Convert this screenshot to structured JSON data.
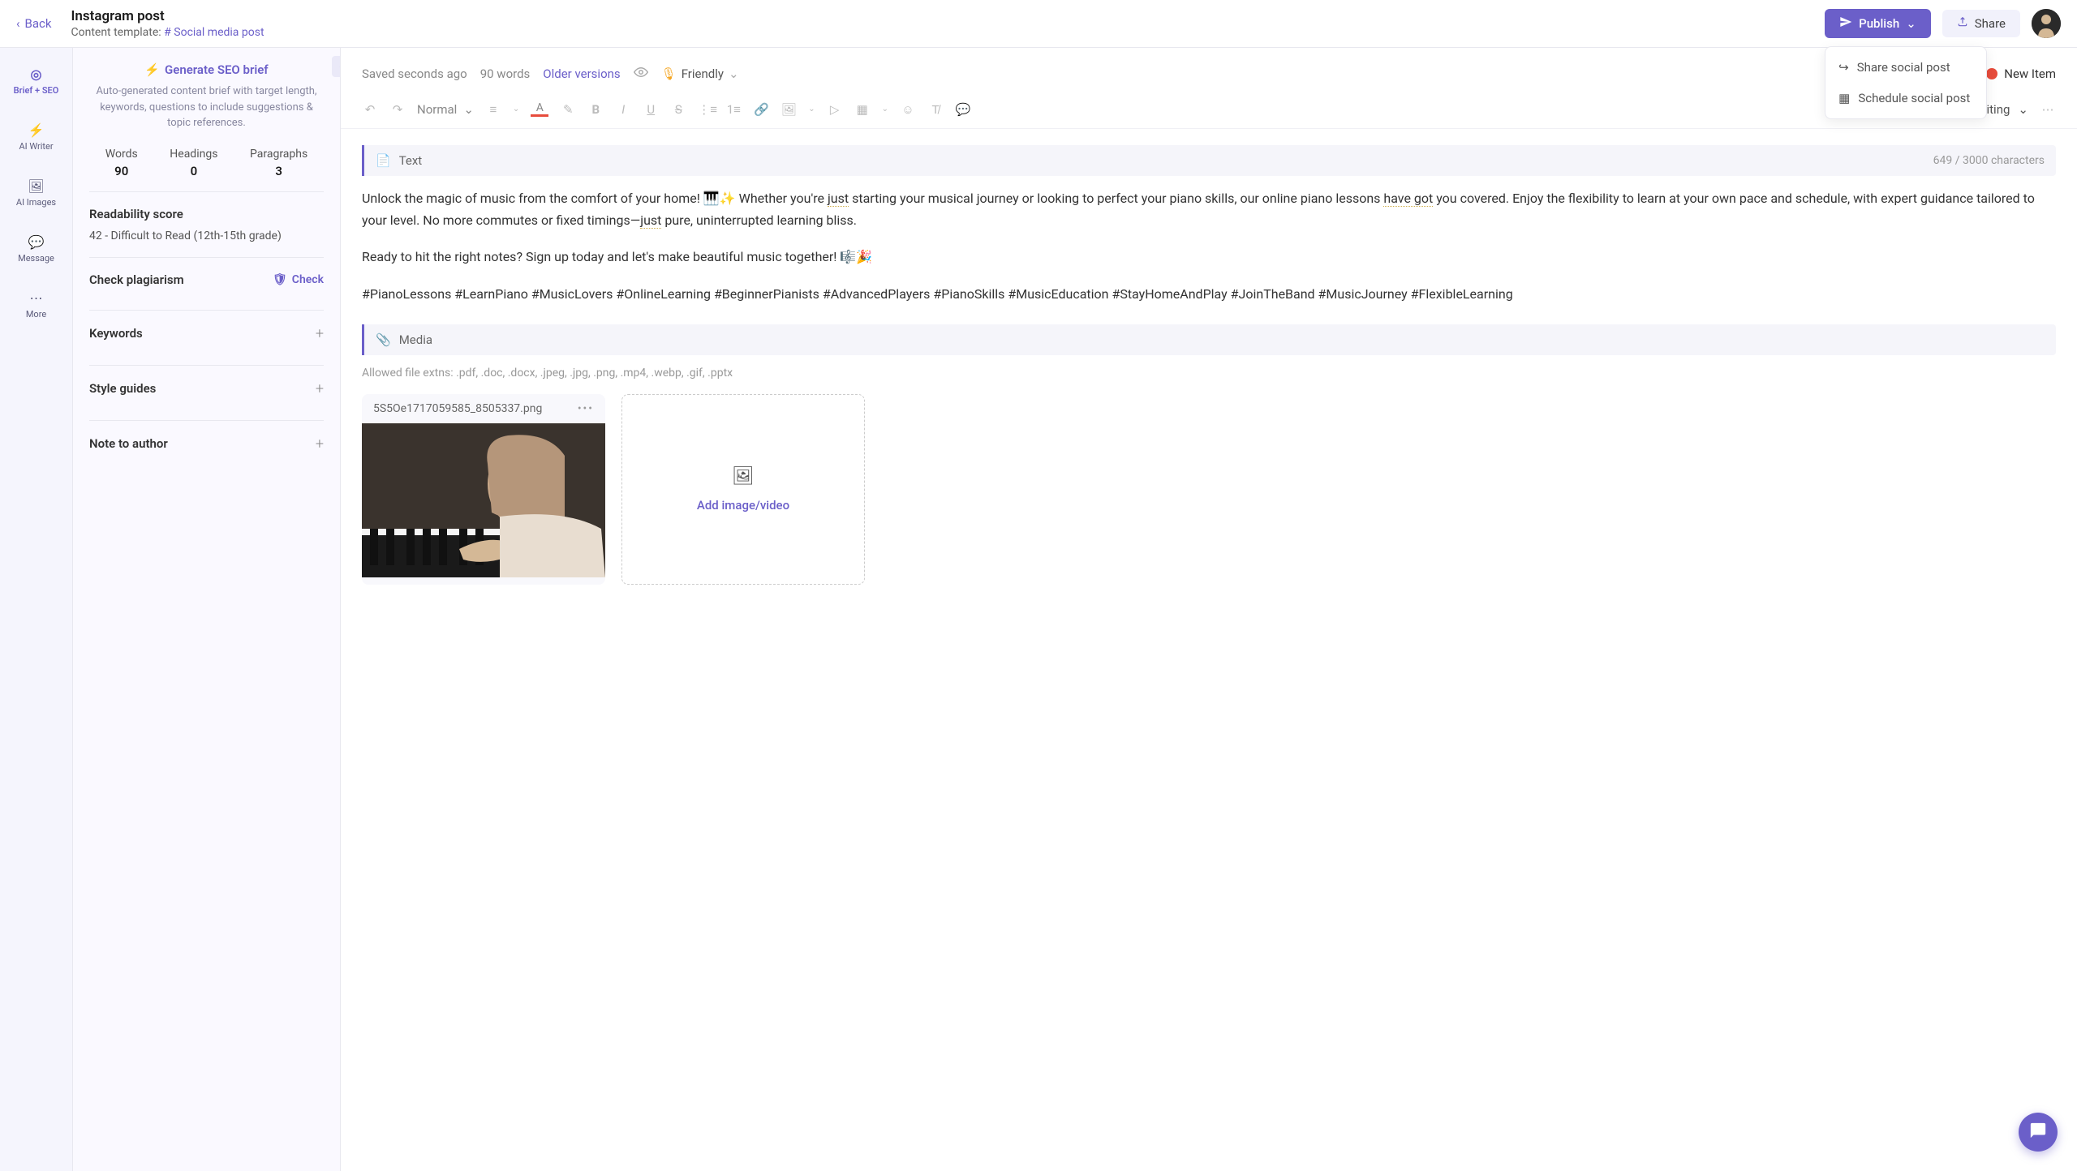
{
  "topbar": {
    "back": "Back",
    "title": "Instagram post",
    "template_label": "Content template:",
    "template_link": "Social media post",
    "publish": "Publish",
    "share": "Share",
    "dropdown": {
      "share_post": "Share social post",
      "schedule_post": "Schedule social post"
    }
  },
  "rail": {
    "brief_seo": "Brief + SEO",
    "ai_writer": "AI Writer",
    "ai_images": "AI Images",
    "message": "Message",
    "more": "More"
  },
  "sidebar": {
    "seo_title": "Generate SEO brief",
    "seo_desc": "Auto-generated content brief with target length, keywords, questions to include suggestions & topic references.",
    "stats": {
      "words_label": "Words",
      "words": "90",
      "headings_label": "Headings",
      "headings": "0",
      "paragraphs_label": "Paragraphs",
      "paragraphs": "3"
    },
    "readability_label": "Readability score",
    "readability_value": "42 - Difficult to Read (12th-15th grade)",
    "plagiarism_label": "Check plagiarism",
    "check": "Check",
    "keywords": "Keywords",
    "style_guides": "Style guides",
    "note_author": "Note to author"
  },
  "editor_header": {
    "saved": "Saved seconds ago",
    "words": "90 words",
    "older": "Older versions",
    "tone": "Friendly",
    "new_item": "New Item"
  },
  "toolbar": {
    "format": "Normal",
    "editing": "Editing"
  },
  "content": {
    "text_label": "Text",
    "char_count": "649 / 3000 characters",
    "para1a": "Unlock the magic of music from the comfort of your home! 🎹✨ Whether you're ",
    "para1b": "just",
    "para1c": " starting your musical journey or looking to perfect your piano skills, our online piano lessons ",
    "para1d": "have got",
    "para1e": " you covered. Enjoy the flexibility to learn at your own pace and schedule, with expert guidance tailored to your level. No more commutes or fixed timings—",
    "para1f": "just",
    "para1g": " pure, uninterrupted learning bliss.",
    "para2": "Ready to hit the right notes? Sign up today and let's make beautiful music together! 🎼🎉",
    "para3": "#PianoLessons #LearnPiano #MusicLovers #OnlineLearning #BeginnerPianists #AdvancedPlayers #PianoSkills #MusicEducation #StayHomeAndPlay #JoinTheBand #MusicJourney #FlexibleLearning",
    "media_label": "Media",
    "allowed_ext": "Allowed file extns: .pdf, .doc, .docx, .jpeg, .jpg, .png, .mp4, .webp, .gif, .pptx",
    "filename": "5S5Oe1717059585_8505337.png",
    "add_media": "Add image/video"
  }
}
